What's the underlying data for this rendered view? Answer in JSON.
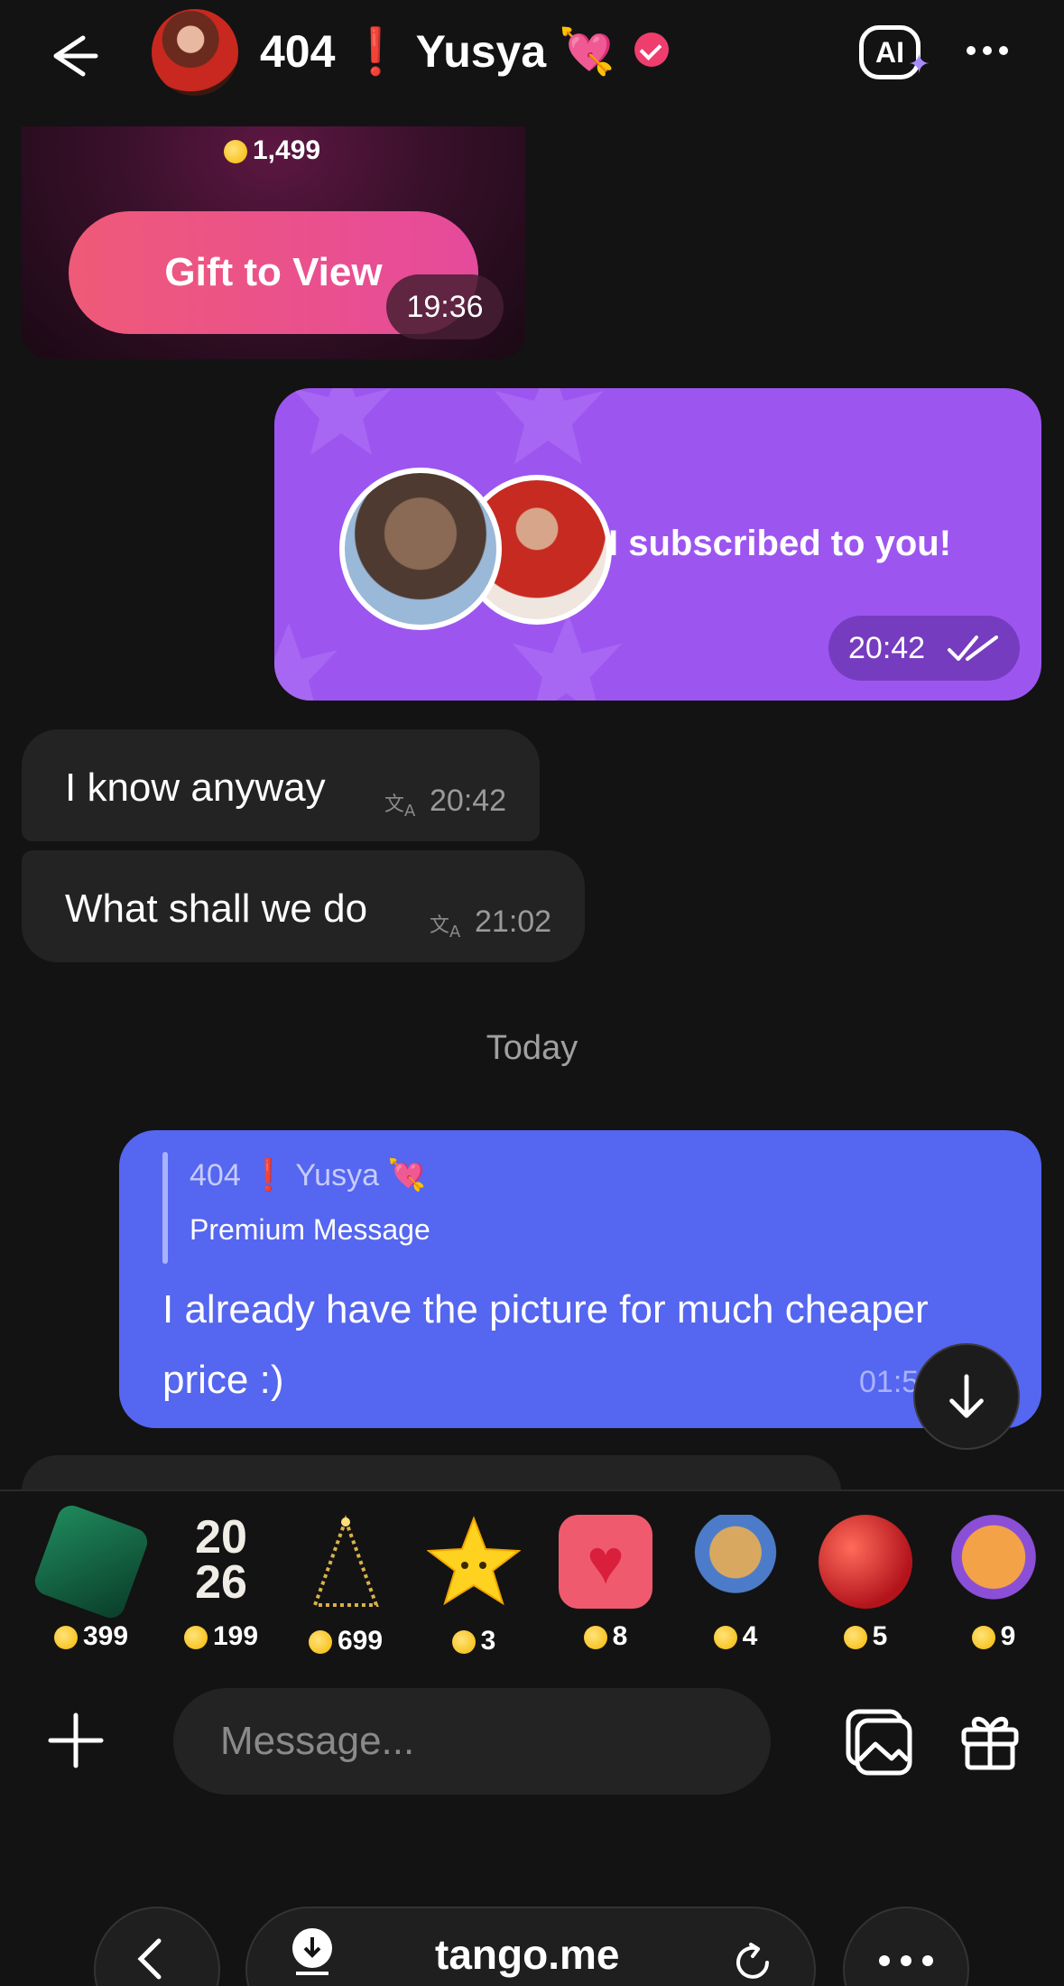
{
  "header": {
    "title_prefix": "404",
    "title_bang": "❗",
    "title_name": "Yusya",
    "title_emoji": "💘",
    "ai_label": "AI"
  },
  "gift_message": {
    "price": "1,499",
    "button_label": "Gift to View",
    "time": "19:36"
  },
  "subscribe_message": {
    "text": "I subscribed to you!",
    "time": "20:42"
  },
  "incoming": [
    {
      "text": "I know anyway",
      "time": "20:42"
    },
    {
      "text": "What shall we do",
      "time": "21:02"
    }
  ],
  "date_separator": "Today",
  "reply_message": {
    "quoted_author_prefix": "404",
    "quoted_author_bang": "❗",
    "quoted_author_name": "Yusya",
    "quoted_author_emoji": "💘",
    "quoted_text": "Premium Message",
    "text": "I already have the picture for much cheaper price :)",
    "time": "01:5"
  },
  "gift_tray": [
    {
      "icon": "green-crystal-gift",
      "price": "399"
    },
    {
      "icon": "2026-gift",
      "price": "199"
    },
    {
      "icon": "golden-tree-gift",
      "price": "699"
    },
    {
      "icon": "star-gift",
      "price": "3"
    },
    {
      "icon": "heart-gift",
      "price": "8"
    },
    {
      "icon": "cat-gift",
      "price": "4"
    },
    {
      "icon": "apple-gift",
      "price": "5"
    },
    {
      "icon": "tiger-gift",
      "price": "9"
    }
  ],
  "composer": {
    "placeholder": "Message..."
  },
  "browser": {
    "url": "tango.me"
  },
  "colors": {
    "background": "#131313",
    "subscribe_bubble": "#9d55f0",
    "reply_bubble": "#5566f0",
    "incoming_bubble": "#232323",
    "gift_button": "#e64a9c"
  }
}
